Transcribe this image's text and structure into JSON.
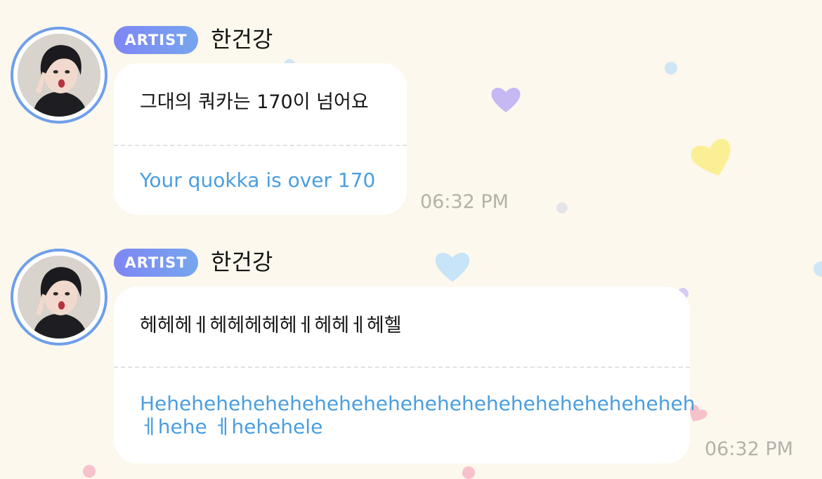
{
  "colors": {
    "background": "#fcf8ed",
    "badge_start": "#7f86f4",
    "badge_end": "#76a6ee",
    "translation_text": "#4a9ee0",
    "timestamp_text": "#b3b1ab",
    "avatar_ring": "#6f9fea"
  },
  "messages": [
    {
      "badge": "ARTIST",
      "sender": "한건강",
      "original": "그대의 쿼카는 170이 넘어요",
      "translation": "Your quokka is over 170",
      "time": "06:32 PM"
    },
    {
      "badge": "ARTIST",
      "sender": "한건강",
      "original": "헤헤헤ㅔ헤헤헤헤헤ㅔ헤헤ㅔ헤헬",
      "translation": "Heheheheheheheheheheheheheheheheheheheheheheh ㅔhehe ㅔhehehele",
      "time": "06:32 PM"
    }
  ],
  "icons": {
    "avatar": "artist-profile-photo",
    "decor": [
      "purple-heart-icon",
      "yellow-heart-icon",
      "blue-heart-icon",
      "pink-heart-icon"
    ]
  }
}
